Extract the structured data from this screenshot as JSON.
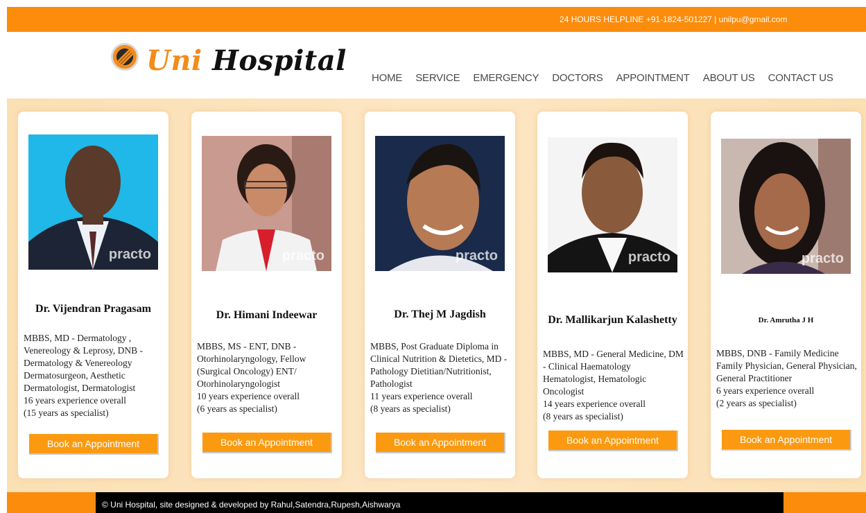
{
  "topbar": {
    "helpline": "24 HOURS HELPLINE +91-1824-501227 | unilpu@gmail.com"
  },
  "logo": {
    "uni": "Uni",
    "hospital": "Hospital"
  },
  "nav": [
    "HOME",
    "SERVICE",
    "EMERGENCY",
    "DOCTORS",
    "APPOINTMENT",
    "ABOUT US",
    "CONTACT US"
  ],
  "doctors": [
    {
      "name": "Dr. Vijendran Pragasam",
      "qualifications": "MBBS, MD - Dermatology , Venereology & Leprosy, DNB - Dermatology & Venereology Dermatosurgeon, Aesthetic Dermatologist, Dermatologist",
      "experience": "16 years experience overall",
      "specialist": "(15 years as specialist)",
      "button": "Book an Appointment",
      "watermark": "practo",
      "photo_bg": "#1fb8e8"
    },
    {
      "name": "Dr. Himani Indeewar",
      "qualifications": "MBBS, MS - ENT, DNB - Otorhinolaryngology, Fellow (Surgical Oncology) ENT/ Otorhinolaryngologist",
      "experience": "10 years experience overall",
      "specialist": "(6 years as specialist)",
      "button": "Book an Appointment",
      "watermark": "practo",
      "photo_bg": "#c99a8f"
    },
    {
      "name": "Dr. Thej M Jagdish",
      "qualifications": "MBBS, Post Graduate Diploma in Clinical Nutrition & Dietetics, MD - Pathology Dietitian/Nutritionist, Pathologist",
      "experience": "11 years experience overall",
      "specialist": "(8 years as specialist)",
      "button": "Book an Appointment",
      "watermark": "practo",
      "photo_bg": "#1a2a4a"
    },
    {
      "name": "Dr. Mallikarjun Kalashetty",
      "qualifications": "MBBS, MD - General Medicine, DM - Clinical Haematology Hematologist, Hematologic Oncologist",
      "experience": "14 years experience overall",
      "specialist": "(8 years as specialist)",
      "button": "Book an Appointment",
      "watermark": "practo",
      "photo_bg": "#f4f4f4"
    },
    {
      "name": "Dr. Amrutha J H",
      "qualifications": "MBBS, DNB - Family Medicine Family Physician, General Physician, General Practitioner",
      "experience": "6 years experience overall",
      "specialist": "(2 years as specialist)",
      "button": "Book an Appointment",
      "watermark": "practo",
      "photo_bg": "#c8b8b0"
    }
  ],
  "footer": {
    "text": "© Uni Hospital, site designed & developed by Rahul,Satendra,Rupesh,Aishwarya"
  }
}
